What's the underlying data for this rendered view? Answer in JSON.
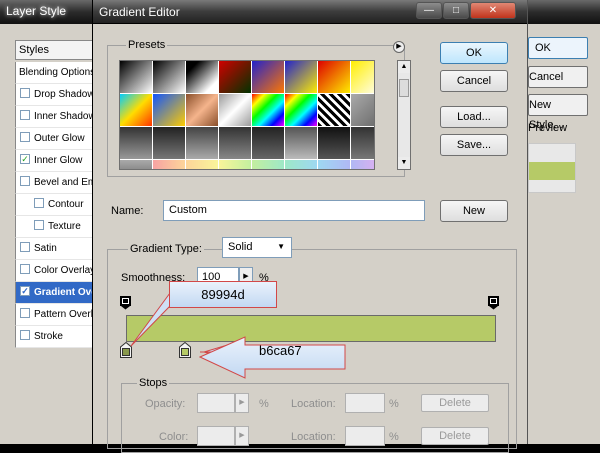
{
  "background_window": {
    "title": "Layer Style",
    "styles_header": "Styles",
    "style_items": [
      {
        "label": "Blending Options",
        "checkbox": false,
        "checked": false,
        "selected": false,
        "indent": false
      },
      {
        "label": "Drop Shadow",
        "checkbox": true,
        "checked": false,
        "selected": false,
        "indent": false
      },
      {
        "label": "Inner Shadow",
        "checkbox": true,
        "checked": false,
        "selected": false,
        "indent": false
      },
      {
        "label": "Outer Glow",
        "checkbox": true,
        "checked": false,
        "selected": false,
        "indent": false
      },
      {
        "label": "Inner Glow",
        "checkbox": true,
        "checked": true,
        "selected": false,
        "indent": false
      },
      {
        "label": "Bevel and Emboss",
        "checkbox": true,
        "checked": false,
        "selected": false,
        "indent": false
      },
      {
        "label": "Contour",
        "checkbox": true,
        "checked": false,
        "selected": false,
        "indent": true
      },
      {
        "label": "Texture",
        "checkbox": true,
        "checked": false,
        "selected": false,
        "indent": true
      },
      {
        "label": "Satin",
        "checkbox": true,
        "checked": false,
        "selected": false,
        "indent": false
      },
      {
        "label": "Color Overlay",
        "checkbox": true,
        "checked": false,
        "selected": false,
        "indent": false
      },
      {
        "label": "Gradient Overlay",
        "checkbox": true,
        "checked": true,
        "selected": true,
        "indent": false
      },
      {
        "label": "Pattern Overlay",
        "checkbox": true,
        "checked": false,
        "selected": false,
        "indent": false
      },
      {
        "label": "Stroke",
        "checkbox": true,
        "checked": false,
        "selected": false,
        "indent": false
      }
    ],
    "ok_label": "OK",
    "cancel_label": "Cancel",
    "new_style_label": "New Style...",
    "preview_label": "Preview",
    "preview_color": "#b6ca67"
  },
  "gradient_editor": {
    "title": "Gradient Editor",
    "titlebar_buttons": {
      "minimize": "—",
      "maximize": "□",
      "close": "✕"
    },
    "presets_label": "Presets",
    "presets_menu_icon": "▶",
    "ok_label": "OK",
    "cancel_label": "Cancel",
    "load_label": "Load...",
    "save_label": "Save...",
    "name_label": "Name:",
    "name_value": "Custom",
    "new_label": "New",
    "gradient_type_label": "Gradient Type:",
    "gradient_type_value": "Solid",
    "smoothness_label": "Smoothness:",
    "smoothness_value": "100",
    "smoothness_unit": "%",
    "stops_label": "Stops",
    "opacity_label": "Opacity:",
    "location_label": "Location:",
    "color_label": "Color:",
    "percent": "%",
    "delete_label": "Delete",
    "color_stops": [
      {
        "color": "#89994d",
        "location": 0
      },
      {
        "color": "#b6ca67",
        "location": 16
      }
    ],
    "gradient_color": "#b6ca67",
    "swatches": [
      "linear-gradient(135deg,#000,#fff)",
      "linear-gradient(135deg,#000,#fff)",
      "linear-gradient(135deg,#000 20%,#fff 80%)",
      "linear-gradient(135deg,#d00000,#003300)",
      "linear-gradient(135deg,#2222cc,#ff7700)",
      "linear-gradient(135deg,#2222cc,#ffee00)",
      "linear-gradient(135deg,#dd0000,#ffee00)",
      "linear-gradient(135deg,#ffee00,#ffffff)",
      "linear-gradient(135deg,#00ccff,#ffdd00 50%,#ff3300)",
      "linear-gradient(135deg,#1155ff,#ffcc00)",
      "linear-gradient(135deg,#8a4f2a,#f5b48c,#8a4f2a)",
      "linear-gradient(135deg,#9a9a9a,#ffffff,#9a9a9a)",
      "linear-gradient(135deg,#ff0000,#ffff00,#00ff00,#00ffff,#0000ff,#ff00ff)",
      "linear-gradient(135deg,#ff0000,#ffff00,#00ff00,#00ffff,#0000ff,#ff00ff)",
      "repeating-linear-gradient(45deg,#000 0 3px,#fff 3px 6px)",
      "linear-gradient(135deg,#aaaaaa,#666666)",
      "linear-gradient(180deg,#333,#999)",
      "linear-gradient(180deg,#222,#777)",
      "linear-gradient(180deg,#444,#aaa)",
      "linear-gradient(180deg,#333,#888)",
      "linear-gradient(180deg,#222,#666)",
      "linear-gradient(180deg,#555,#bbb)",
      "linear-gradient(180deg,#111,#555)",
      "linear-gradient(180deg,#333,#777)",
      "linear-gradient(180deg,#aaa,#444)",
      "linear-gradient(90deg,#f7a3a3,#fcd59a)",
      "linear-gradient(90deg,#fcd59a,#f9f59a)",
      "linear-gradient(90deg,#f9f59a,#c3ef9f)",
      "linear-gradient(90deg,#c3ef9f,#9ee8c7)",
      "linear-gradient(90deg,#9ee8c7,#9ed8f2)",
      "linear-gradient(90deg,#9ed8f2,#b0b8f4)",
      "linear-gradient(90deg,#b0b8f4,#e4aef0)"
    ]
  },
  "callouts": {
    "first": "89994d",
    "second": "b6ca67"
  }
}
